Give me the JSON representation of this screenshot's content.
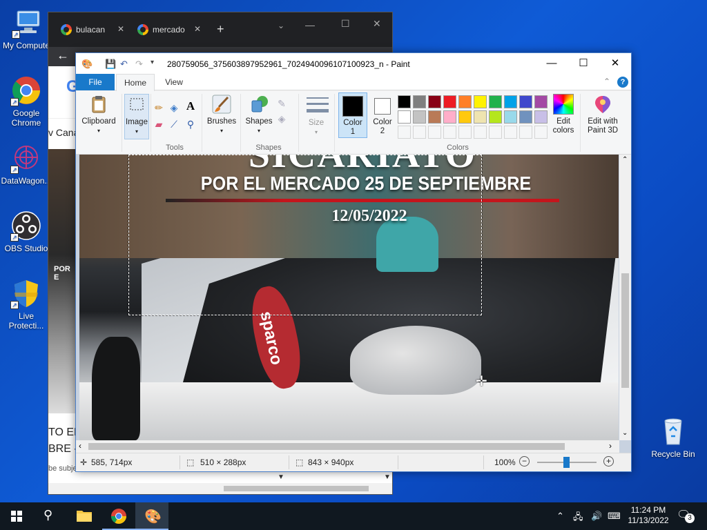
{
  "desktop": {
    "icons": [
      {
        "label": "My Computer"
      },
      {
        "label": "Google Chrome"
      },
      {
        "label": "DataWagon..."
      },
      {
        "label": "OBS Studio"
      },
      {
        "label": "Live Protecti..."
      },
      {
        "label": "Recycle Bin"
      }
    ]
  },
  "chrome": {
    "tabs": [
      {
        "label": "bulacan"
      },
      {
        "label": "mercado"
      }
    ],
    "partial_texts": [
      "v Cana",
      "POR E",
      "TO EN",
      "BRE -",
      "be subje"
    ]
  },
  "paint": {
    "title": "280759056_375603897952961_7024940096107100923_n - Paint",
    "menu_tabs": {
      "file": "File",
      "home": "Home",
      "view": "View"
    },
    "ribbon": {
      "clipboard": "Clipboard",
      "image": "Image",
      "tools": "Tools",
      "brushes": "Brushes",
      "shapes_btn": "Shapes",
      "shapes_group": "Shapes",
      "size": "Size",
      "color1": "Color\n1",
      "color1_l1": "Color",
      "color1_l2": "1",
      "color2_l1": "Color",
      "color2_l2": "2",
      "colors_group": "Colors",
      "edit_colors_l1": "Edit",
      "edit_colors_l2": "colors",
      "paint3d_l1": "Edit with",
      "paint3d_l2": "Paint 3D"
    },
    "palette_row1": [
      "#000000",
      "#7f7f7f",
      "#880015",
      "#ed1c24",
      "#ff7f27",
      "#fff200",
      "#22b14c",
      "#00a2e8",
      "#3f48cc",
      "#a349a4"
    ],
    "palette_row2": [
      "#ffffff",
      "#c3c3c3",
      "#b97a57",
      "#ffaec9",
      "#ffc90e",
      "#efe4b0",
      "#b5e61d",
      "#99d9ea",
      "#7092be",
      "#c8bfe7"
    ],
    "color1_value": "#000000",
    "color2_value": "#ffffff",
    "image_text": {
      "top": "SICARIATO",
      "line": "POR EL MERCADO 25 DE SEPTIEMBRE",
      "date": "12/05/2022",
      "seat": "sparco"
    },
    "status": {
      "cursor": "585, 714px",
      "selection": "510 × 288px",
      "size": "843 × 940px",
      "zoom": "100%"
    }
  },
  "taskbar": {
    "time": "11:24 PM",
    "date": "11/13/2022",
    "notifications": "3"
  }
}
